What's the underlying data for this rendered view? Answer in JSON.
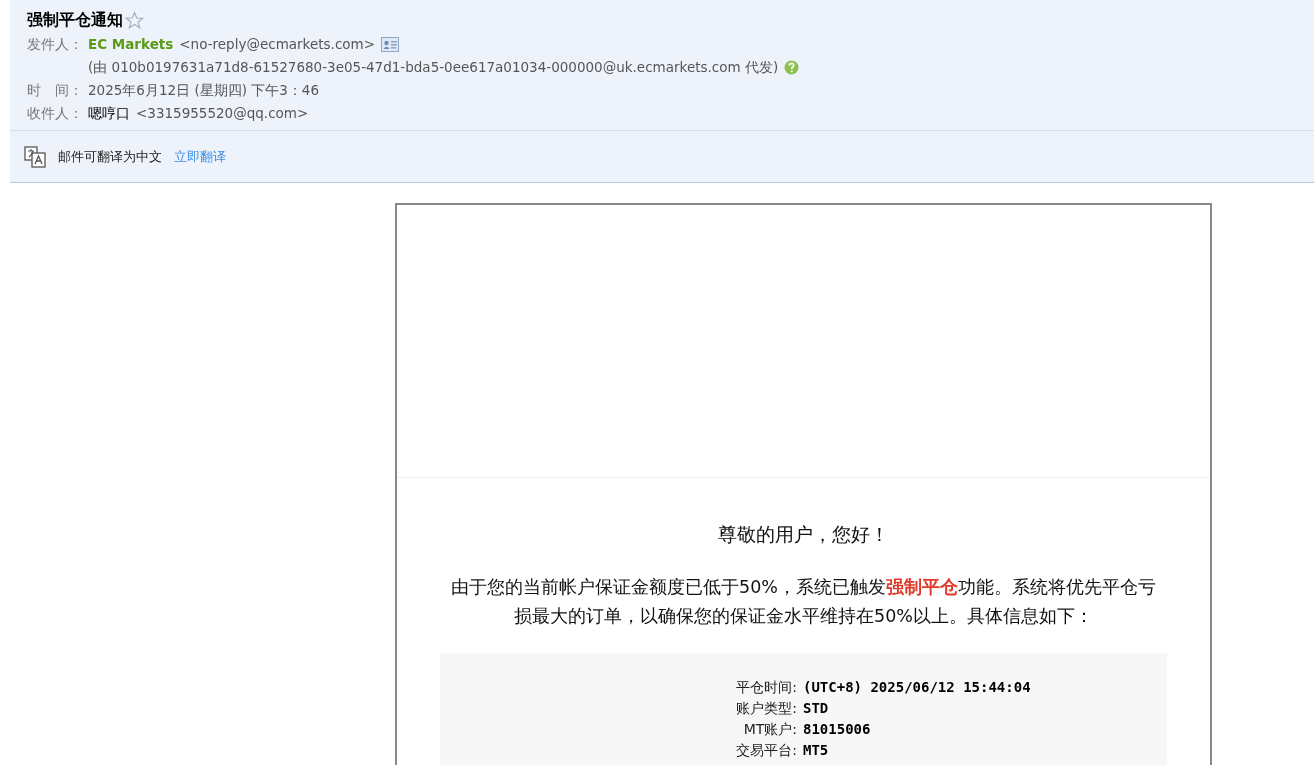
{
  "header": {
    "subject": "强制平仓通知",
    "starred": false,
    "fields": [
      {
        "kind": "sender",
        "label": "发件人：",
        "name": "EC Markets",
        "address": "<no-reply@ecmarkets.com>",
        "proxy": "(由 010b0197631a71d8-61527680-3e05-47d1-bda5-0ee617a01034-000000@uk.ecmarkets.com 代发)"
      },
      {
        "kind": "plain",
        "label": "时　间：",
        "value": "2025年6月12日 (星期四) 下午3：46"
      },
      {
        "kind": "recipient",
        "label": "收件人：",
        "name": "嗯哼口",
        "address": "<3315955520@qq.com>"
      }
    ]
  },
  "translate_bar": {
    "text": "邮件可翻译为中文",
    "link": "立即翻译"
  },
  "body": {
    "greeting": "尊敬的用户，您好！",
    "paragraph": [
      {
        "text": "由于您的当前帐户保证金额度已低于50%，系统已触发",
        "highlight": false
      },
      {
        "text": "强制平仓",
        "highlight": true
      },
      {
        "text": "功能。系统将优先平仓亏损最大的订单，以确保您的保证金水平维持在50%以上。具体信息如下：",
        "highlight": false
      }
    ],
    "details": [
      {
        "label": "平仓时间:",
        "value": "(UTC+8) 2025/06/12 15:44:04"
      },
      {
        "label": "账户类型:",
        "value": "STD"
      },
      {
        "label": "MT账户:",
        "value": "81015006"
      },
      {
        "label": "交易平台:",
        "value": "MT5"
      }
    ]
  }
}
